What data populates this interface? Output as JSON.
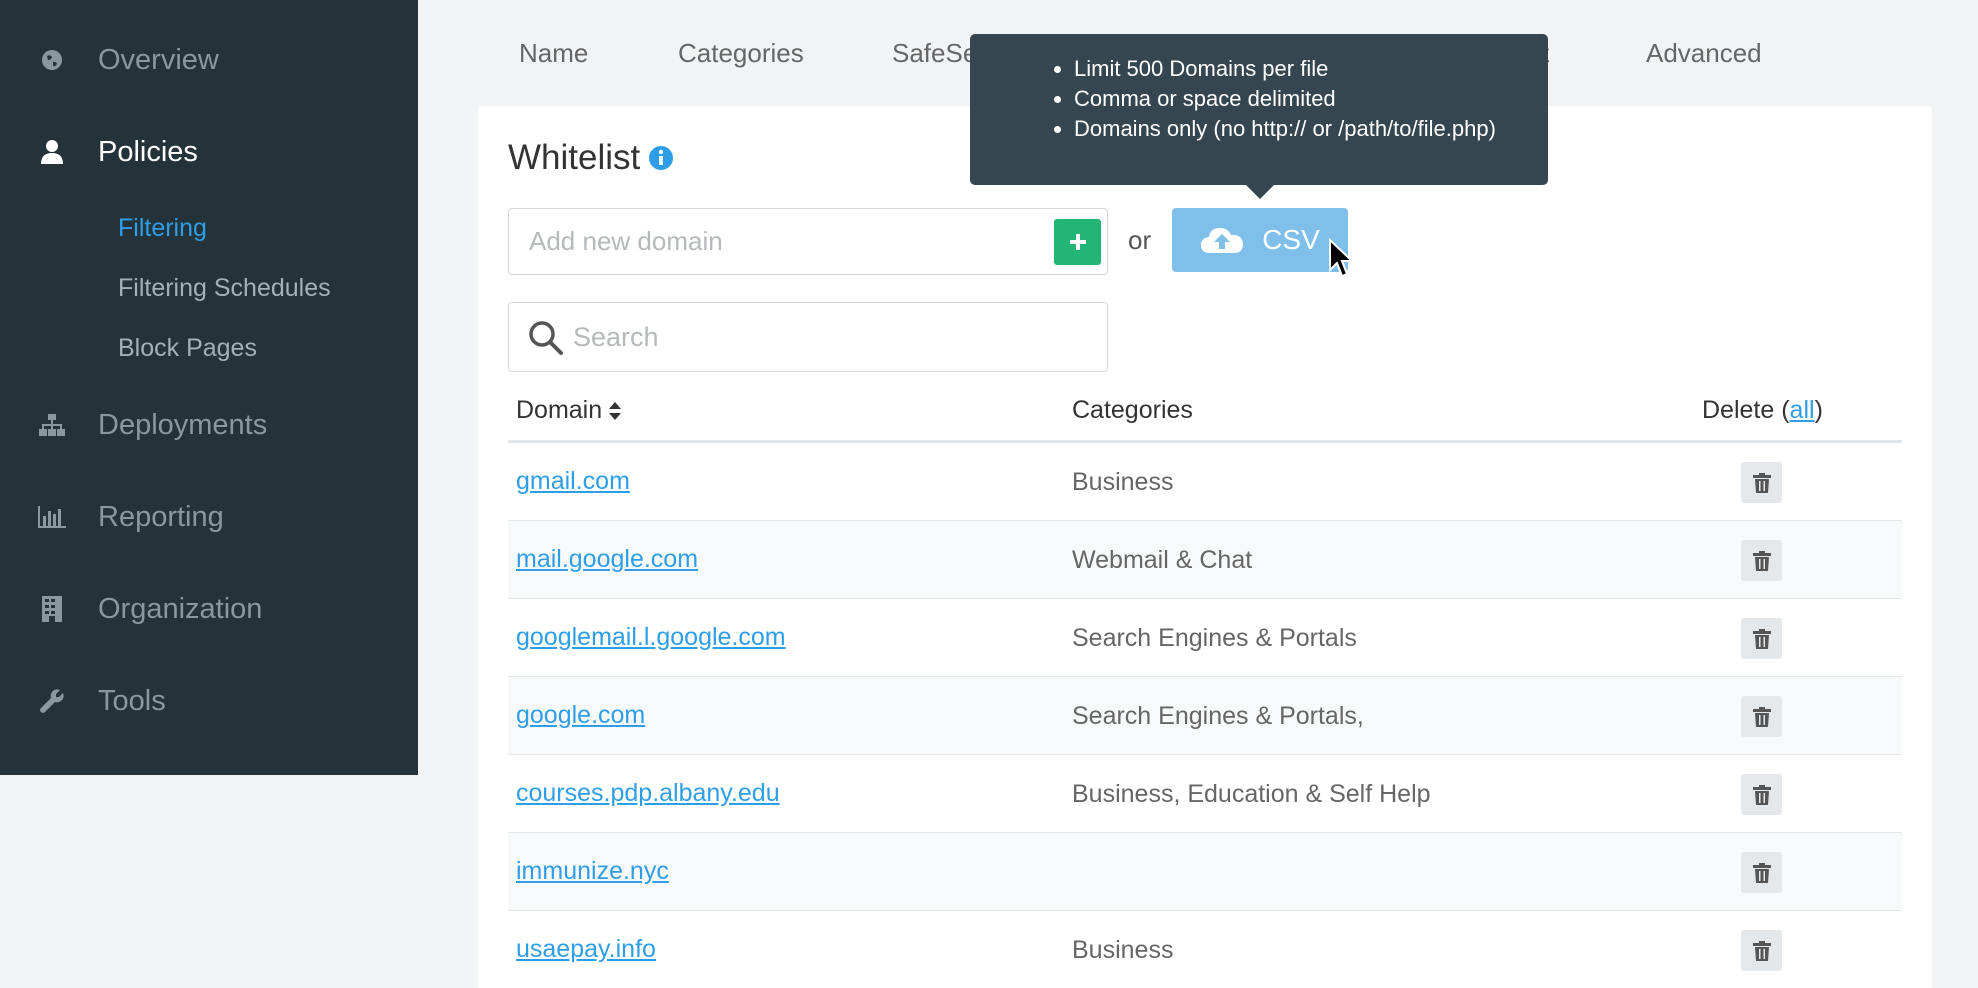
{
  "sidebar": {
    "items": [
      {
        "label": "Overview",
        "icon": "globe-icon"
      },
      {
        "label": "Policies",
        "icon": "user-icon"
      },
      {
        "label": "Deployments",
        "icon": "sitemap-icon"
      },
      {
        "label": "Reporting",
        "icon": "bar-chart-icon"
      },
      {
        "label": "Organization",
        "icon": "building-icon"
      },
      {
        "label": "Tools",
        "icon": "wrench-icon"
      }
    ],
    "sub_items": [
      {
        "label": "Filtering"
      },
      {
        "label": "Filtering Schedules"
      },
      {
        "label": "Block Pages"
      }
    ],
    "active_item": "Policies",
    "active_sub_item": "Filtering"
  },
  "tabs": [
    {
      "label": "Name"
    },
    {
      "label": "Categories"
    },
    {
      "label": "SafeSe"
    },
    {
      "label": "t"
    },
    {
      "label": "Advanced"
    }
  ],
  "whitelist": {
    "title": "Whitelist",
    "add_placeholder": "Add new domain",
    "or_text": "or",
    "csv_label": "CSV",
    "search_placeholder": "Search"
  },
  "tooltip": {
    "lines": [
      "Limit 500 Domains per file",
      "Comma or space delimited",
      "Domains only (no http:// or /path/to/file.php)"
    ]
  },
  "table": {
    "headers": {
      "domain": "Domain",
      "categories": "Categories",
      "delete": "Delete (",
      "delete_all": "all",
      "delete_close": ")"
    },
    "rows": [
      {
        "domain": "gmail.com",
        "categories": "Business"
      },
      {
        "domain": "mail.google.com",
        "categories": "Webmail & Chat"
      },
      {
        "domain": "googlemail.l.google.com",
        "categories": "Search Engines & Portals"
      },
      {
        "domain": "google.com",
        "categories": "Search Engines & Portals,"
      },
      {
        "domain": "courses.pdp.albany.edu",
        "categories": "Business, Education & Self Help"
      },
      {
        "domain": "immunize.nyc",
        "categories": ""
      },
      {
        "domain": "usaepay.info",
        "categories": "Business"
      }
    ]
  },
  "colors": {
    "sidebar_bg": "#243239",
    "accent": "#2f9ee8",
    "add_button": "#22b573",
    "csv_button": "#7fbfea",
    "tooltip_bg": "#354650"
  }
}
